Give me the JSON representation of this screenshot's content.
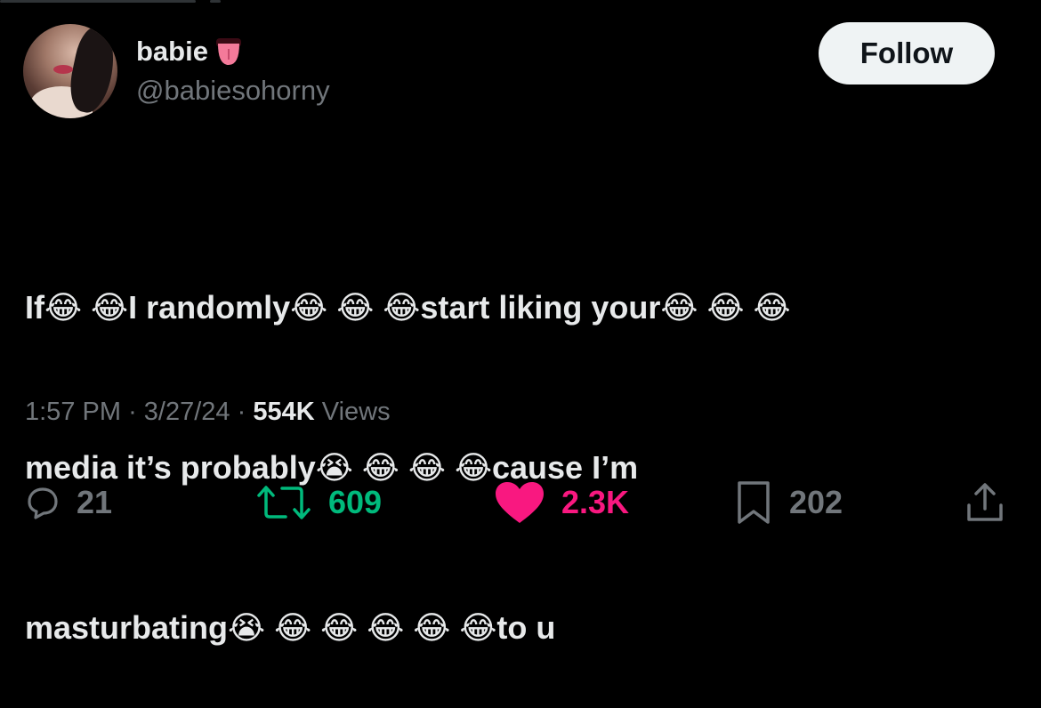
{
  "author": {
    "display_name": "babie",
    "handle": "@babiesohorny",
    "name_emoji": "tongue-emoji"
  },
  "follow_button": {
    "label": "Follow"
  },
  "tweet": {
    "lines": [
      "If😂 😂I randomly😂 😂 😂start liking your😂 😂 😂",
      "media it’s probably😭 😂 😂 😂cause I’m",
      "masturbating😭 😂 😂 😂 😂 😂to u"
    ]
  },
  "meta": {
    "time": "1:57 PM",
    "separator": "·",
    "date": "3/27/24",
    "views_count": "554K",
    "views_label": "Views"
  },
  "actions": {
    "replies": "21",
    "reposts": "609",
    "likes": "2.3K",
    "bookmarks": "202"
  },
  "colors": {
    "background": "#000000",
    "text": "#e7e9ea",
    "secondary": "#71767b",
    "repost": "#00ba7c",
    "like": "#f91880",
    "follow_bg": "#eff3f4"
  }
}
